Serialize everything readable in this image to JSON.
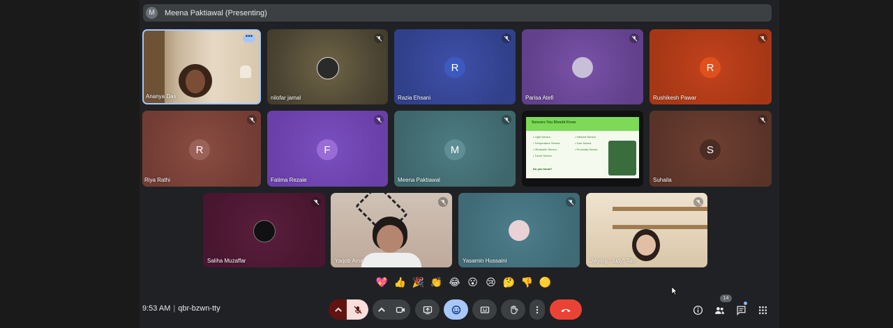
{
  "presenting_banner": {
    "avatar_letter": "M",
    "text": "Meena Paktiawal (Presenting)"
  },
  "participants": [
    {
      "name": "Ananya Das"
    },
    {
      "name": "nilofar jamal"
    },
    {
      "name": "Razia Ehsani",
      "initial": "R"
    },
    {
      "name": "Parisa Atefi"
    },
    {
      "name": "Rushikesh Pawar",
      "initial": "R"
    },
    {
      "name": "Riya Rathi",
      "initial": "R"
    },
    {
      "name": "Fatima Rezaie",
      "initial": "F"
    },
    {
      "name": "Meena Paktiawal",
      "initial": "M"
    },
    {
      "name": "Suhaila",
      "initial": "S"
    },
    {
      "name": "Saliha Muzaffar"
    },
    {
      "name": "Yaqob Amir"
    },
    {
      "name": "Yasamin Hussaini"
    },
    {
      "name": "Jieying \"Judy\" Tan"
    }
  ],
  "presentation_tile": {
    "slide_title": "Sensors You Should Know",
    "col1": [
      "• Light Sensor",
      "• Temperature Sensor",
      "• Ultrasonic Sensor",
      "• Touch Sensor"
    ],
    "col2": [
      "• Infrared Sensor",
      "• Gas Sensor",
      "• Proximity Sensor"
    ],
    "question": "Do you know?"
  },
  "reactions": [
    "💖",
    "👍",
    "🎉",
    "👏",
    "😂",
    "😮",
    "😢",
    "🤔",
    "👎",
    "🟡"
  ],
  "meeting": {
    "time": "9:53 AM",
    "separator": "|",
    "code": "qbr-bzwn-tty"
  },
  "people_count": "14",
  "colors": {
    "end_call": "#ea4335",
    "mic_off_bg": "#f9dedc",
    "active_blue": "#a8c7fa",
    "control_gray": "#3c4043"
  }
}
